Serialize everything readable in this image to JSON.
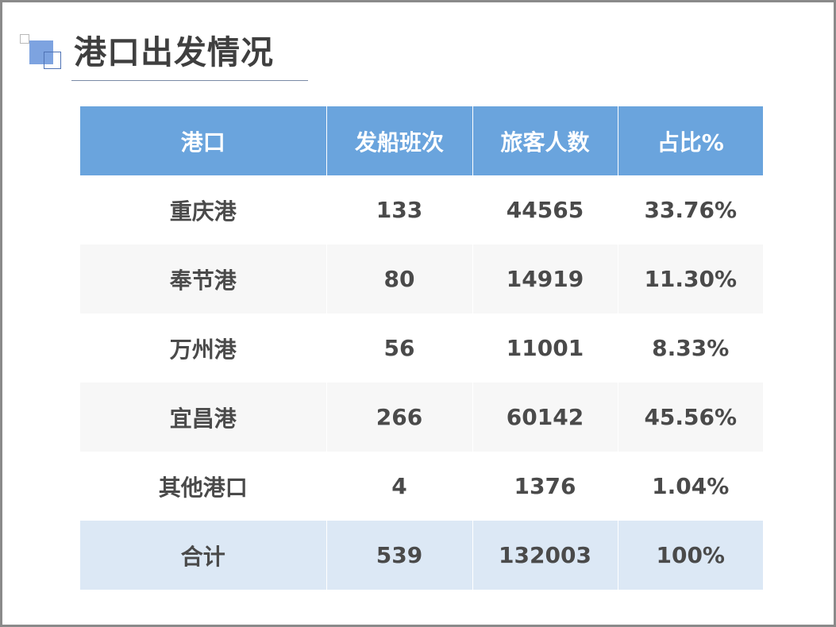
{
  "slide": {
    "title": "港口出发情况"
  },
  "table": {
    "headers": [
      "港口",
      "发船班次",
      "旅客人数",
      "占比%"
    ],
    "rows": [
      [
        "重庆港",
        "133",
        "44565",
        "33.76%"
      ],
      [
        "奉节港",
        "80",
        "14919",
        "11.30%"
      ],
      [
        "万州港",
        "56",
        "11001",
        "8.33%"
      ],
      [
        "宜昌港",
        "266",
        "60142",
        "45.56%"
      ],
      [
        "其他港口",
        "4",
        "1376",
        "1.04%"
      ],
      [
        "合计",
        "539",
        "132003",
        "100%"
      ]
    ]
  },
  "colors": {
    "header_bg": "#6aa4dd",
    "header_text": "#ffffff",
    "total_row_bg": "#dce8f5",
    "stripe_bg": "#f7f7f7",
    "accent_square": "#7da3e0"
  }
}
